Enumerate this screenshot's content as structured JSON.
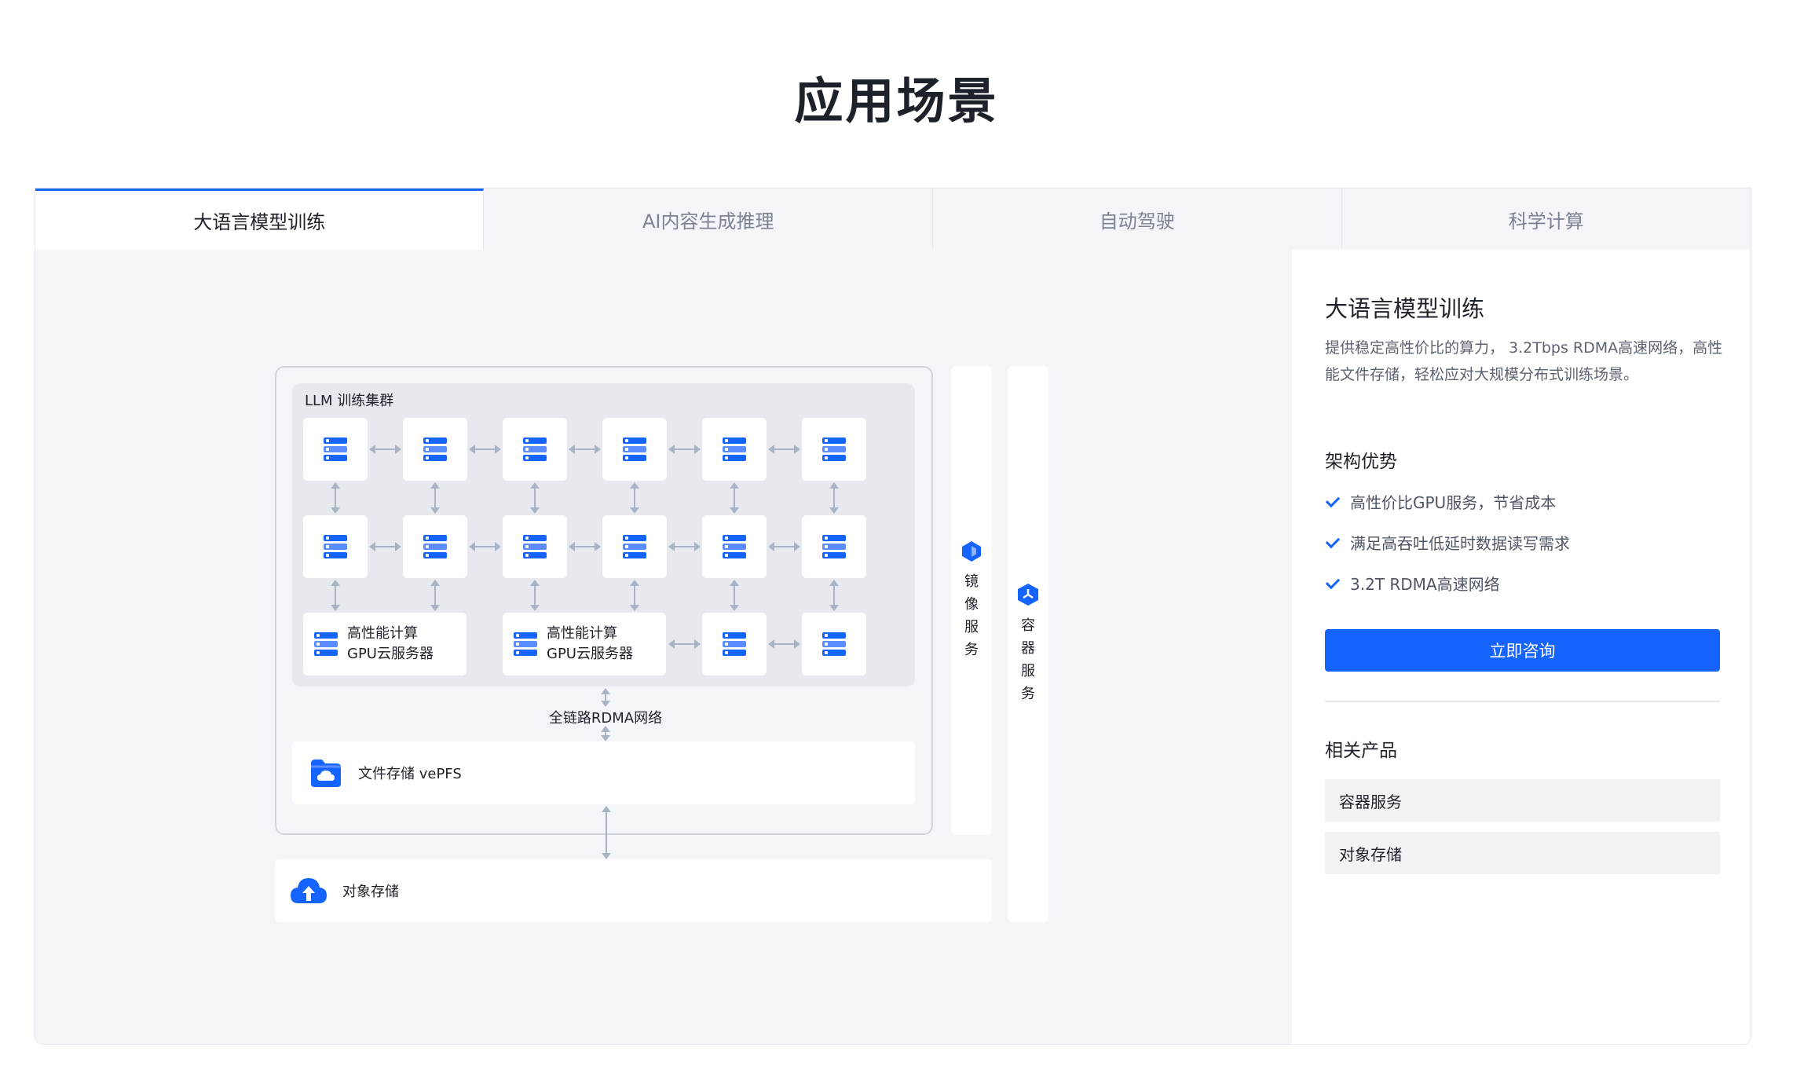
{
  "page_title": "应用场景",
  "tabs": [
    {
      "label": "大语言模型训练",
      "active": true
    },
    {
      "label": "AI内容生成推理",
      "active": false
    },
    {
      "label": "自动驾驶",
      "active": false
    },
    {
      "label": "科学计算",
      "active": false
    }
  ],
  "diagram": {
    "cluster_label": "LLM 训练集群",
    "gpu_server_label_line1": "高性能计算",
    "gpu_server_label_line2": "GPU云服务器",
    "rdma_label": "全链路RDMA网络",
    "file_storage_label": "文件存储 vePFS",
    "object_storage_label": "对象存储",
    "image_service_label": "镜像服务",
    "container_service_label": "容器服务",
    "colors": {
      "accent": "#1664ff",
      "connector": "#aab3c4"
    }
  },
  "side": {
    "title": "大语言模型训练",
    "description": "提供稳定高性价比的算力， 3.2Tbps RDMA高速网络，高性能文件存储，轻松应对大规模分布式训练场景。",
    "advantages_title": "架构优势",
    "advantages": [
      "高性价比GPU服务，节省成本",
      "满足高吞吐低延时数据读写需求",
      "3.2T RDMA高速网络"
    ],
    "cta_label": "立即咨询",
    "related_title": "相关产品",
    "related_products": [
      "容器服务",
      "对象存储"
    ]
  }
}
